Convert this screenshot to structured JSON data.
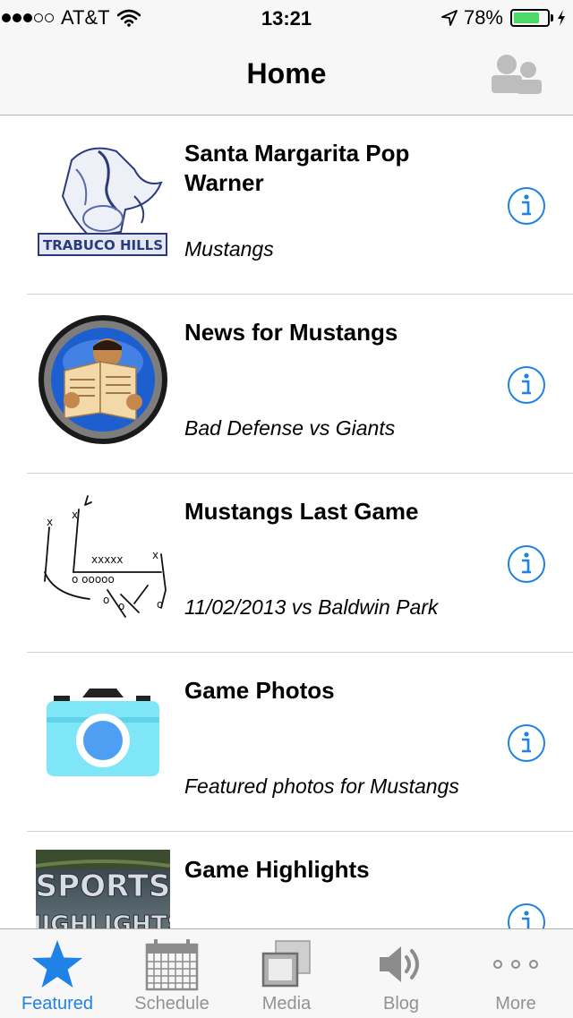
{
  "status_bar": {
    "carrier": "AT&T",
    "time": "13:21",
    "battery_percent": "78%",
    "battery_level": 0.78,
    "signal_bars_filled": 3,
    "signal_bars_total": 5
  },
  "nav": {
    "title": "Home",
    "right_icon": "profile-group-icon"
  },
  "list": {
    "items": [
      {
        "title": "Santa Margarita Pop Warner",
        "subtitle": "Mustangs",
        "thumbnail": "mustang-logo"
      },
      {
        "title": "News for Mustangs",
        "subtitle": "Bad Defense vs Giants",
        "thumbnail": "newspaper-reader-icon"
      },
      {
        "title": "Mustangs Last Game",
        "subtitle": "11/02/2013 vs Baldwin Park",
        "thumbnail": "football-play-diagram"
      },
      {
        "title": "Game Photos",
        "subtitle": "Featured photos for Mustangs",
        "thumbnail": "camera-icon"
      },
      {
        "title": "Game Highlights",
        "subtitle": "",
        "thumbnail": "sports-highlights-image",
        "thumbnail_text": "SPORTS HIGHLIGHTS"
      }
    ]
  },
  "tabs": [
    {
      "label": "Featured",
      "icon": "star-icon",
      "active": true
    },
    {
      "label": "Schedule",
      "icon": "calendar-icon",
      "active": false
    },
    {
      "label": "Media",
      "icon": "media-icon",
      "active": false
    },
    {
      "label": "Blog",
      "icon": "speaker-icon",
      "active": false
    },
    {
      "label": "More",
      "icon": "more-dots-icon",
      "active": false
    }
  ],
  "colors": {
    "accent": "#1e82e6",
    "battery_fill": "#4cd964",
    "bar_background": "#f7f7f7",
    "inactive_tab": "#929292",
    "camera_body": "#7ee6f6"
  }
}
